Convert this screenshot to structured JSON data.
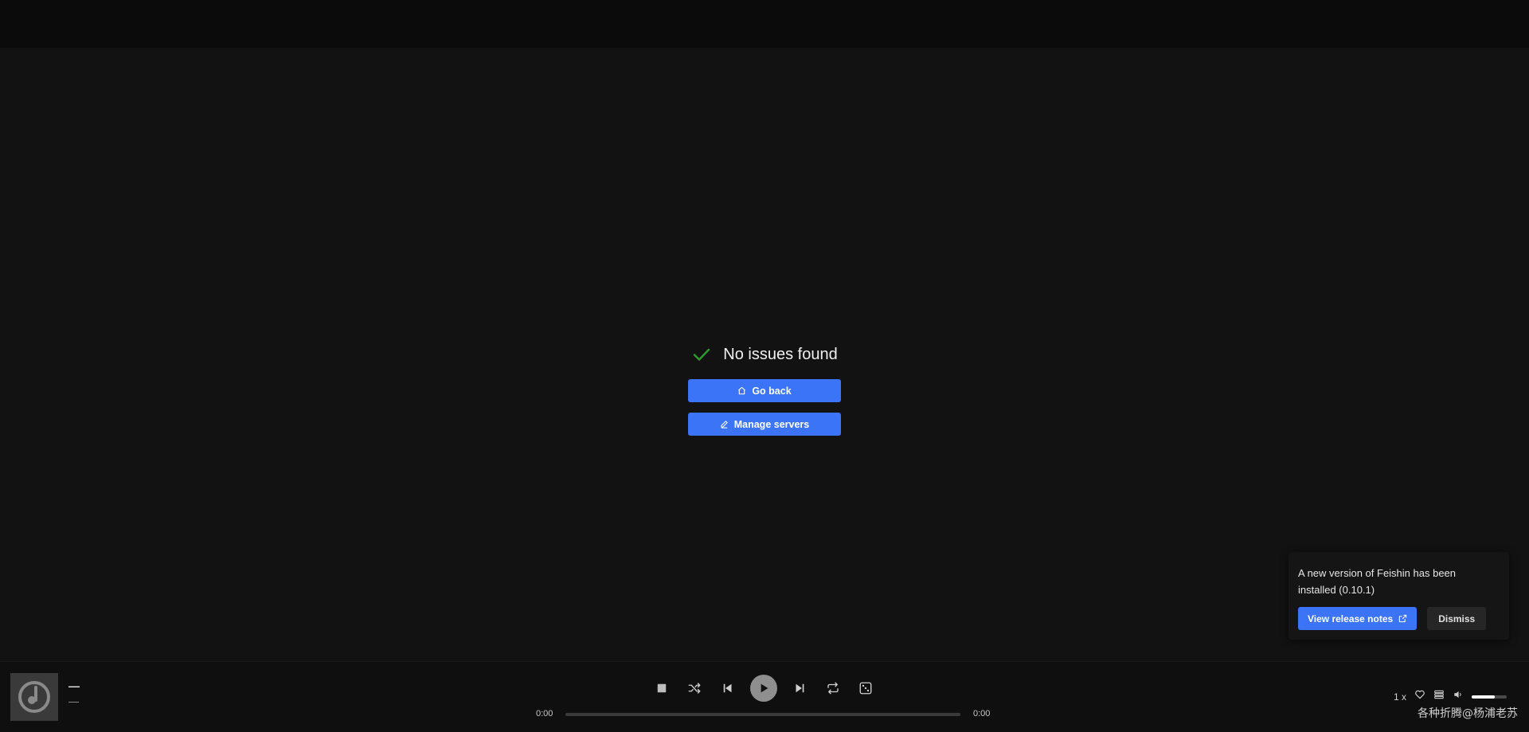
{
  "main": {
    "status_text": "No issues found",
    "go_back_label": "Go back",
    "manage_servers_label": "Manage servers",
    "status_icon": "checkmark-icon",
    "status_color": "#2e9a2e"
  },
  "toast": {
    "message": "A new version of Feishin has been installed (0.10.1)",
    "release_notes_label": "View release notes",
    "dismiss_label": "Dismiss"
  },
  "player": {
    "track_title": "—",
    "track_artist": "—",
    "time_current": "0:00",
    "time_total": "0:00",
    "progress": 0,
    "speed": "1 x",
    "volume": 0.65,
    "watermark": "各种折腾@杨浦老苏"
  },
  "colors": {
    "accent": "#3b74f6",
    "background": "#121212",
    "titlebar": "#0b0b0b"
  }
}
